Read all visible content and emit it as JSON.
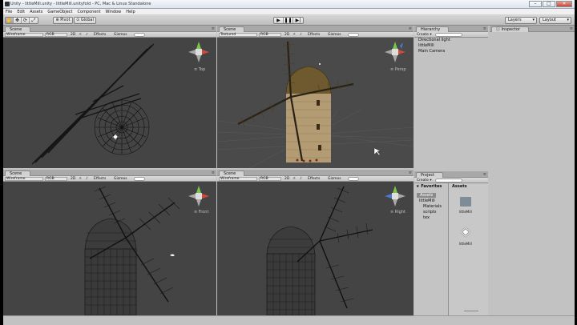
{
  "window": {
    "title": "Unity - littleMill.unity - littleMill.unityfold - PC, Mac & Linux Standalone"
  },
  "menu": [
    "File",
    "Edit",
    "Assets",
    "GameObject",
    "Component",
    "Window",
    "Help"
  ],
  "toolbar": {
    "pivot": "Pivot",
    "global": "Global",
    "layers": "Layers",
    "layout": "Layout"
  },
  "scene": {
    "tab": "Scene",
    "top": {
      "mode": "Wireframe",
      "color": "RGB",
      "dim": "2D",
      "effects": "Effects",
      "gizmos": "Gizmos",
      "view": "Top"
    },
    "persp": {
      "mode": "Textured",
      "color": "RGB",
      "dim": "2D",
      "effects": "Effects",
      "gizmos": "Gizmos",
      "view": "Persp"
    },
    "front": {
      "mode": "Wireframe",
      "color": "RGB",
      "dim": "2D",
      "effects": "Effects",
      "gizmos": "Gizmos",
      "view": "Front"
    },
    "right": {
      "mode": "Wireframe",
      "color": "RGB",
      "dim": "2D",
      "effects": "Effects",
      "gizmos": "Gizmos",
      "view": "Right"
    }
  },
  "hierarchy": {
    "tab": "Hierarchy",
    "create": "Create",
    "items": [
      "Directional light",
      "littleMill",
      "Main Camera"
    ]
  },
  "project": {
    "tab": "Project",
    "create": "Create",
    "favorites": "Favorites",
    "assets_header": "Assets",
    "tree": [
      "Assets",
      "littleMill",
      "Materials",
      "scripts",
      "tex"
    ],
    "assets": [
      "littleMill",
      "littleMill"
    ]
  },
  "inspector": {
    "tab": "Inspector"
  }
}
